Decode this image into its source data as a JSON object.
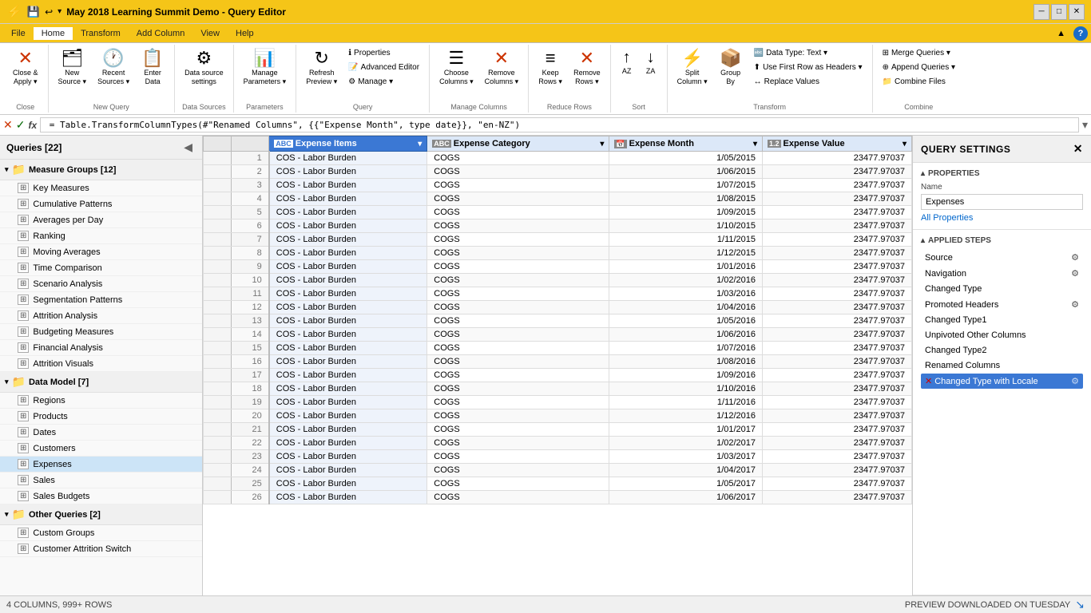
{
  "titleBar": {
    "icon": "⚡",
    "title": "May 2018 Learning Summit Demo - Query Editor",
    "minimize": "─",
    "restore": "□",
    "close": "✕"
  },
  "menuBar": {
    "items": [
      "File",
      "Home",
      "Transform",
      "Add Column",
      "View",
      "Help"
    ],
    "active": "Home"
  },
  "ribbon": {
    "groups": [
      {
        "label": "Close",
        "buttons": [
          {
            "id": "close-apply",
            "icon": "✕",
            "label": "Close &\nApply ▾"
          }
        ]
      },
      {
        "label": "New Query",
        "buttons": [
          {
            "id": "new-source",
            "icon": "🗂",
            "label": "New\nSource ▾"
          },
          {
            "id": "recent-sources",
            "icon": "🕐",
            "label": "Recent\nSources ▾"
          },
          {
            "id": "enter-data",
            "icon": "📋",
            "label": "Enter\nData"
          }
        ]
      },
      {
        "label": "Data Sources",
        "buttons": [
          {
            "id": "data-source-settings",
            "icon": "⚙",
            "label": "Data source\nsettings"
          }
        ]
      },
      {
        "label": "Parameters",
        "buttons": [
          {
            "id": "manage-parameters",
            "icon": "📊",
            "label": "Manage\nParameters ▾"
          }
        ]
      },
      {
        "label": "Query",
        "buttons": [
          {
            "id": "refresh-preview",
            "icon": "↻",
            "label": "Refresh\nPreview ▾"
          }
        ]
      },
      {
        "label": "Query",
        "buttons": [
          {
            "id": "properties",
            "icon": "ℹ",
            "label": "Properties"
          },
          {
            "id": "advanced-editor",
            "icon": "📝",
            "label": "Advanced Editor"
          },
          {
            "id": "manage",
            "icon": "⚙",
            "label": "Manage ▾"
          }
        ]
      },
      {
        "label": "Manage Columns",
        "buttons": [
          {
            "id": "choose-columns",
            "icon": "☰",
            "label": "Choose\nColumns ▾"
          },
          {
            "id": "remove-columns",
            "icon": "✕",
            "label": "Remove\nColumns ▾"
          }
        ]
      },
      {
        "label": "Reduce Rows",
        "buttons": [
          {
            "id": "keep-rows",
            "icon": "≡",
            "label": "Keep\nRows ▾"
          },
          {
            "id": "remove-rows",
            "icon": "✕",
            "label": "Remove\nRows ▾"
          }
        ]
      },
      {
        "label": "Sort",
        "buttons": [
          {
            "id": "sort-az",
            "icon": "↕",
            "label": ""
          },
          {
            "id": "sort-za",
            "icon": "↕",
            "label": ""
          }
        ]
      },
      {
        "label": "Transform",
        "buttons": [
          {
            "id": "split-column",
            "icon": "⚡",
            "label": "Split\nColumn ▾"
          },
          {
            "id": "group-by",
            "icon": "📦",
            "label": "Group\nBy"
          }
        ],
        "smallButtons": [
          {
            "id": "data-type",
            "icon": "🔤",
            "label": "Data Type: Text ▾"
          },
          {
            "id": "use-first-row",
            "icon": "⬆",
            "label": "Use First Row as Headers ▾"
          },
          {
            "id": "replace-values",
            "icon": "↔",
            "label": "Replace Values"
          }
        ]
      },
      {
        "label": "Combine",
        "buttons": [
          {
            "id": "merge-queries",
            "icon": "⊞",
            "label": "Merge Queries ▾"
          },
          {
            "id": "append-queries",
            "icon": "⊕",
            "label": "Append Queries ▾"
          },
          {
            "id": "combine-files",
            "icon": "📁",
            "label": "Combine Files"
          }
        ]
      }
    ]
  },
  "formulaBar": {
    "checkIcon": "✓",
    "cancelIcon": "✕",
    "fxLabel": "fx",
    "formula": " = Table.TransformColumnTypes(#\"Renamed Columns\", {{\"Expense Month\", type date}}, \"en-NZ\")"
  },
  "queriesPanel": {
    "title": "Queries [22]",
    "groups": [
      {
        "id": "measure-groups",
        "label": "Measure Groups [12]",
        "expanded": true,
        "items": [
          {
            "id": "key-measures",
            "label": "Key Measures"
          },
          {
            "id": "cumulative-patterns",
            "label": "Cumulative Patterns"
          },
          {
            "id": "averages-per-day",
            "label": "Averages per Day"
          },
          {
            "id": "ranking",
            "label": "Ranking"
          },
          {
            "id": "moving-averages",
            "label": "Moving Averages"
          },
          {
            "id": "time-comparison",
            "label": "Time Comparison"
          },
          {
            "id": "scenario-analysis",
            "label": "Scenario Analysis"
          },
          {
            "id": "segmentation-patterns",
            "label": "Segmentation Patterns"
          },
          {
            "id": "attrition-analysis",
            "label": "Attrition Analysis"
          },
          {
            "id": "budgeting-measures",
            "label": "Budgeting Measures"
          },
          {
            "id": "financial-analysis",
            "label": "Financial Analysis"
          },
          {
            "id": "attrition-visuals",
            "label": "Attrition Visuals"
          }
        ]
      },
      {
        "id": "data-model",
        "label": "Data Model [7]",
        "expanded": true,
        "items": [
          {
            "id": "regions",
            "label": "Regions"
          },
          {
            "id": "products",
            "label": "Products"
          },
          {
            "id": "dates",
            "label": "Dates"
          },
          {
            "id": "customers",
            "label": "Customers"
          },
          {
            "id": "expenses",
            "label": "Expenses",
            "selected": true
          },
          {
            "id": "sales",
            "label": "Sales"
          },
          {
            "id": "sales-budgets",
            "label": "Sales Budgets"
          }
        ]
      },
      {
        "id": "other-queries",
        "label": "Other Queries [2]",
        "expanded": true,
        "items": [
          {
            "id": "custom-groups",
            "label": "Custom Groups"
          },
          {
            "id": "customer-attrition-switch",
            "label": "Customer Attrition Switch"
          }
        ]
      }
    ]
  },
  "dataGrid": {
    "columns": [
      {
        "id": "expense-items",
        "label": "Expense Items",
        "type": "ABC",
        "selected": true
      },
      {
        "id": "expense-category",
        "label": "Expense Category",
        "type": "ABC"
      },
      {
        "id": "expense-month",
        "label": "Expense Month",
        "type": "📅"
      },
      {
        "id": "expense-value",
        "label": "Expense Value",
        "type": "1.2"
      }
    ],
    "rows": [
      [
        1,
        "COS - Labor Burden",
        "COGS",
        "1/05/2015",
        "23477.97037"
      ],
      [
        2,
        "COS - Labor Burden",
        "COGS",
        "1/06/2015",
        "23477.97037"
      ],
      [
        3,
        "COS - Labor Burden",
        "COGS",
        "1/07/2015",
        "23477.97037"
      ],
      [
        4,
        "COS - Labor Burden",
        "COGS",
        "1/08/2015",
        "23477.97037"
      ],
      [
        5,
        "COS - Labor Burden",
        "COGS",
        "1/09/2015",
        "23477.97037"
      ],
      [
        6,
        "COS - Labor Burden",
        "COGS",
        "1/10/2015",
        "23477.97037"
      ],
      [
        7,
        "COS - Labor Burden",
        "COGS",
        "1/11/2015",
        "23477.97037"
      ],
      [
        8,
        "COS - Labor Burden",
        "COGS",
        "1/12/2015",
        "23477.97037"
      ],
      [
        9,
        "COS - Labor Burden",
        "COGS",
        "1/01/2016",
        "23477.97037"
      ],
      [
        10,
        "COS - Labor Burden",
        "COGS",
        "1/02/2016",
        "23477.97037"
      ],
      [
        11,
        "COS - Labor Burden",
        "COGS",
        "1/03/2016",
        "23477.97037"
      ],
      [
        12,
        "COS - Labor Burden",
        "COGS",
        "1/04/2016",
        "23477.97037"
      ],
      [
        13,
        "COS - Labor Burden",
        "COGS",
        "1/05/2016",
        "23477.97037"
      ],
      [
        14,
        "COS - Labor Burden",
        "COGS",
        "1/06/2016",
        "23477.97037"
      ],
      [
        15,
        "COS - Labor Burden",
        "COGS",
        "1/07/2016",
        "23477.97037"
      ],
      [
        16,
        "COS - Labor Burden",
        "COGS",
        "1/08/2016",
        "23477.97037"
      ],
      [
        17,
        "COS - Labor Burden",
        "COGS",
        "1/09/2016",
        "23477.97037"
      ],
      [
        18,
        "COS - Labor Burden",
        "COGS",
        "1/10/2016",
        "23477.97037"
      ],
      [
        19,
        "COS - Labor Burden",
        "COGS",
        "1/11/2016",
        "23477.97037"
      ],
      [
        20,
        "COS - Labor Burden",
        "COGS",
        "1/12/2016",
        "23477.97037"
      ],
      [
        21,
        "COS - Labor Burden",
        "COGS",
        "1/01/2017",
        "23477.97037"
      ],
      [
        22,
        "COS - Labor Burden",
        "COGS",
        "1/02/2017",
        "23477.97037"
      ],
      [
        23,
        "COS - Labor Burden",
        "COGS",
        "1/03/2017",
        "23477.97037"
      ],
      [
        24,
        "COS - Labor Burden",
        "COGS",
        "1/04/2017",
        "23477.97037"
      ],
      [
        25,
        "COS - Labor Burden",
        "COGS",
        "1/05/2017",
        "23477.97037"
      ],
      [
        26,
        "COS - Labor Burden",
        "COGS",
        "1/06/2017",
        "23477.97037"
      ]
    ]
  },
  "querySettings": {
    "title": "QUERY SETTINGS",
    "propertiesLabel": "▴ PROPERTIES",
    "nameLabel": "Name",
    "nameValue": "Expenses",
    "allPropertiesLink": "All Properties",
    "appliedStepsLabel": "▴ APPLIED STEPS",
    "steps": [
      {
        "id": "source",
        "label": "Source",
        "hasGear": true,
        "active": false,
        "hasError": false
      },
      {
        "id": "navigation",
        "label": "Navigation",
        "hasGear": true,
        "active": false,
        "hasError": false
      },
      {
        "id": "changed-type",
        "label": "Changed Type",
        "hasGear": false,
        "active": false,
        "hasError": false
      },
      {
        "id": "promoted-headers",
        "label": "Promoted Headers",
        "hasGear": true,
        "active": false,
        "hasError": false
      },
      {
        "id": "changed-type1",
        "label": "Changed Type1",
        "hasGear": false,
        "active": false,
        "hasError": false
      },
      {
        "id": "unpivoted-other-columns",
        "label": "Unpivoted Other Columns",
        "hasGear": false,
        "active": false,
        "hasError": false
      },
      {
        "id": "changed-type2",
        "label": "Changed Type2",
        "hasGear": false,
        "active": false,
        "hasError": false
      },
      {
        "id": "renamed-columns",
        "label": "Renamed Columns",
        "hasGear": false,
        "active": false,
        "hasError": false
      },
      {
        "id": "changed-type-with-locale",
        "label": "Changed Type with Locale",
        "hasGear": true,
        "active": true,
        "hasError": true
      }
    ]
  },
  "statusBar": {
    "info": "4 COLUMNS, 999+ ROWS",
    "preview": "PREVIEW DOWNLOADED ON TUESDAY"
  }
}
